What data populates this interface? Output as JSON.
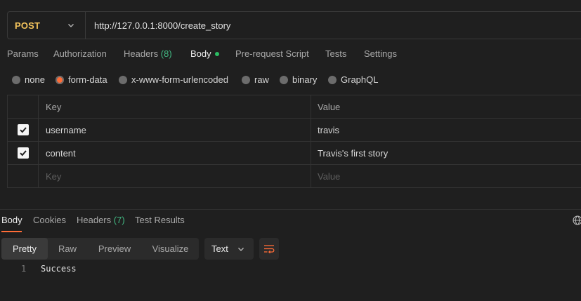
{
  "request": {
    "method": "POST",
    "url": "http://127.0.0.1:8000/create_story"
  },
  "request_tabs": {
    "params": "Params",
    "authorization": "Authorization",
    "headers": "Headers",
    "headers_count": "(8)",
    "body": "Body",
    "prerequest": "Pre-request Script",
    "tests": "Tests",
    "settings": "Settings"
  },
  "body_types": {
    "none": "none",
    "form_data": "form-data",
    "urlencoded": "x-www-form-urlencoded",
    "raw": "raw",
    "binary": "binary",
    "graphql": "GraphQL",
    "selected": "form-data"
  },
  "form_table": {
    "headers": {
      "key": "Key",
      "value": "Value"
    },
    "rows": [
      {
        "key": "username",
        "value": "travis",
        "checked": true
      },
      {
        "key": "content",
        "value": "Travis's first story",
        "checked": true
      }
    ],
    "placeholder": {
      "key": "Key",
      "value": "Value"
    }
  },
  "response_tabs": {
    "body": "Body",
    "cookies": "Cookies",
    "headers": "Headers",
    "headers_count": "(7)",
    "test_results": "Test Results"
  },
  "response_view": {
    "modes": [
      "Pretty",
      "Raw",
      "Preview",
      "Visualize"
    ],
    "active_mode": "Pretty",
    "format": "Text"
  },
  "response_body": {
    "lines": [
      {
        "number": "1",
        "text": "Success"
      }
    ]
  },
  "colors": {
    "accent": "#ff6c37",
    "method": "#f3c35c",
    "count": "#42b983",
    "status_dot": "#2bbd63"
  }
}
